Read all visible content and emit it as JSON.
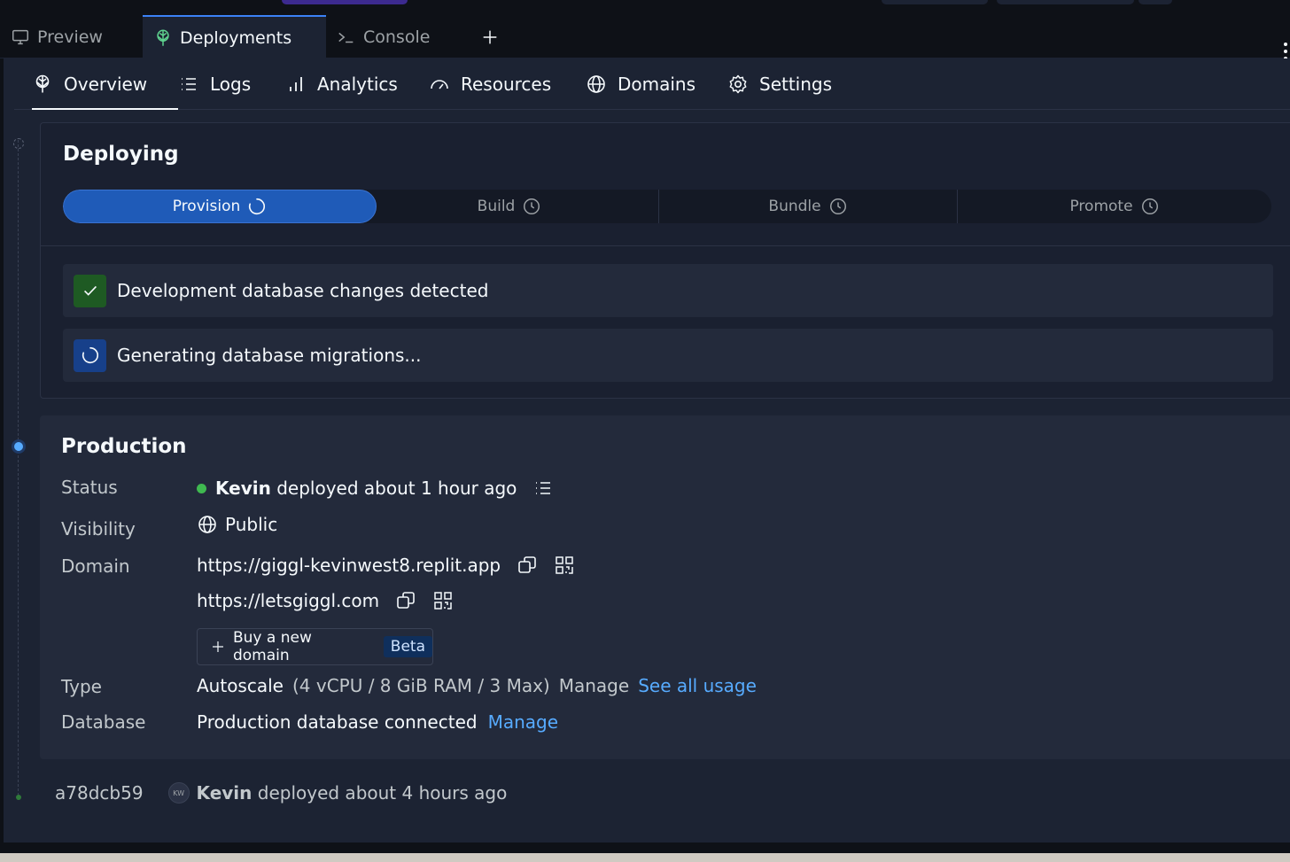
{
  "theme": {
    "bg": "#0e1117",
    "surface": "#1c2333",
    "accent": "#1f5bb8",
    "success": "#3fb950",
    "link": "#57abff",
    "deployments_icon_color": "#5fd38f"
  },
  "tabs": [
    {
      "label": "Preview",
      "icon": "monitor-icon"
    },
    {
      "label": "Deployments",
      "icon": "deployments-icon",
      "active": true
    },
    {
      "label": "Console",
      "icon": "terminal-icon"
    }
  ],
  "subnav": [
    {
      "label": "Overview",
      "icon": "deployments-icon",
      "active": true
    },
    {
      "label": "Logs",
      "icon": "list-icon"
    },
    {
      "label": "Analytics",
      "icon": "bar-chart-icon"
    },
    {
      "label": "Resources",
      "icon": "gauge-icon"
    },
    {
      "label": "Domains",
      "icon": "globe-icon"
    },
    {
      "label": "Settings",
      "icon": "gear-icon"
    }
  ],
  "deploying": {
    "title": "Deploying",
    "steps": [
      {
        "label": "Provision",
        "state": "active",
        "icon": "spinner-icon"
      },
      {
        "label": "Build",
        "state": "pending",
        "icon": "clock-icon"
      },
      {
        "label": "Bundle",
        "state": "pending",
        "icon": "clock-icon"
      },
      {
        "label": "Promote",
        "state": "pending",
        "icon": "clock-icon"
      }
    ],
    "tasks": [
      {
        "text": "Development database changes detected",
        "state": "done",
        "icon": "check-icon"
      },
      {
        "text": "Generating database migrations...",
        "state": "running",
        "icon": "spinner-icon"
      }
    ]
  },
  "production": {
    "title": "Production",
    "status_label": "Status",
    "status_user": "Kevin",
    "status_text": "deployed about 1 hour ago",
    "visibility_label": "Visibility",
    "visibility_value": "Public",
    "domain_label": "Domain",
    "domains": [
      "https://giggl-kevinwest8.replit.app",
      "https://letsgiggl.com"
    ],
    "buy_domain_label": "Buy a new domain",
    "buy_domain_badge": "Beta",
    "type_label": "Type",
    "type_value": "Autoscale",
    "type_spec": "(4 vCPU / 8 GiB RAM / 3 Max)",
    "type_manage": "Manage",
    "type_usage_link": "See all usage",
    "database_label": "Database",
    "database_value": "Production database connected",
    "database_manage": "Manage"
  },
  "history": [
    {
      "commit": "a78dcb59",
      "avatar_initials": "KW",
      "user": "Kevin",
      "text": "deployed about 4 hours ago"
    }
  ]
}
